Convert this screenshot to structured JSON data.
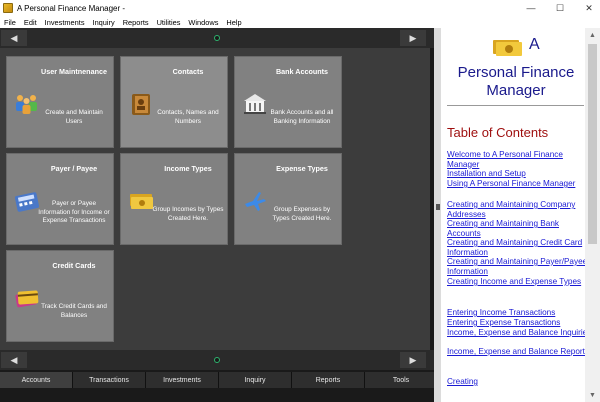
{
  "window": {
    "title": "A Personal Finance Manager -",
    "minimize_label": "—",
    "maximize_label": "☐",
    "close_label": "✕"
  },
  "menu": [
    "File",
    "Edit",
    "Investments",
    "Inquiry",
    "Reports",
    "Utilities",
    "Windows",
    "Help"
  ],
  "nav": {
    "left_glyph": "◀",
    "right_glyph": "▶"
  },
  "tiles": [
    {
      "title": "User Maintnenance",
      "desc": "Create and Maintain Users",
      "icon": "users-icon"
    },
    {
      "title": "Contacts",
      "desc": "Contacts, Names and Numbers",
      "icon": "address-book-icon"
    },
    {
      "title": "Bank Accounts",
      "desc": "Bank Accounts and all Banking Information",
      "icon": "bank-icon"
    },
    {
      "title": "Payer / Payee",
      "desc": "Payer or Payee Information for Income or Expense Transactions",
      "icon": "calculator-icon"
    },
    {
      "title": "Income Types",
      "desc": "Group Incomes by Types Created Here.",
      "icon": "money-icon"
    },
    {
      "title": "Expense Types",
      "desc": "Group Expenses by Types Created Here.",
      "icon": "airplane-icon"
    },
    {
      "title": "Credit Cards",
      "desc": "Track Credit Cards and Balances",
      "icon": "credit-card-icon"
    }
  ],
  "tabs": [
    "Accounts",
    "Transactions",
    "Investments",
    "Inquiry",
    "Reports",
    "Tools"
  ],
  "help": {
    "title_a": "A",
    "title": "Personal Finance Manager",
    "toc_heading": "Table of Contents",
    "links": [
      "Welcome to A Personal Finance Manager",
      "Installation and Setup",
      "Using A Personal Finance Manager",
      "Creating and Maintaining Company Addresses",
      "Creating and Maintaining Bank Accounts",
      "Creating and Maintaining Credit Card Information",
      "Creating and Maintaining Payer/Payee Information",
      "Creating Income and Expense Types",
      "Entering Income Transactions",
      "Entering Expense Transactions",
      "Income, Expense and Balance Inquiries",
      "Income, Expense and Balance Reports",
      "Creating"
    ]
  },
  "colors": {
    "accent": "#2db36d",
    "link": "#1a1ad4",
    "toc_heading": "#9e0e0e",
    "help_title": "#1a1a8c"
  }
}
